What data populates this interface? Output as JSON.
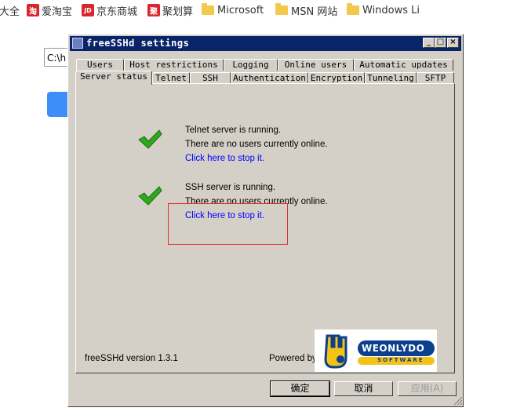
{
  "bookmarks": {
    "items": [
      {
        "label": "大全"
      },
      {
        "label": "爱淘宝",
        "icon": "taobao-icon"
      },
      {
        "label": "京东商城",
        "icon": "jd-icon"
      },
      {
        "label": "聚划算",
        "icon": "juhuasuan-icon"
      },
      {
        "label": "Microsoft",
        "icon": "folder-icon"
      },
      {
        "label": "MSN 网站",
        "icon": "folder-icon"
      },
      {
        "label": "Windows Li",
        "icon": "folder-icon"
      }
    ],
    "icon_glyphs": {
      "taobao": "淘",
      "jd": "JD",
      "juhuasuan": "聚"
    }
  },
  "background": {
    "input_value": "C:\\h"
  },
  "window": {
    "title": "freeSSHd settings",
    "caption_buttons": {
      "minimize": "_",
      "maximize": "□",
      "close": "×"
    }
  },
  "tabs": {
    "row1": [
      "Users",
      "Host restrictions",
      "Logging",
      "Online users",
      "Automatic updates"
    ],
    "row2": [
      "Server status",
      "Telnet",
      "SSH",
      "Authentication",
      "Encryption",
      "Tunneling",
      "SFTP"
    ],
    "active": "Server status"
  },
  "status": {
    "telnet": {
      "running": "Telnet server is running.",
      "users": "There are no users currently online.",
      "link": "Click here to stop it."
    },
    "ssh": {
      "running": "SSH server is running.",
      "users": "There are no users currently online.",
      "link": "Click here to stop it."
    }
  },
  "footer": {
    "version": "freeSSHd version 1.3.1",
    "powered_by": "Powered by",
    "logo_text": "WEONLYDO",
    "logo_sub": "SOFTWARE"
  },
  "buttons": {
    "ok": "确定",
    "cancel": "取消",
    "apply": "应用(A)"
  },
  "colors": {
    "titlebar": "#0a246a",
    "dialog": "#d4d0c8",
    "link": "#0000ff",
    "check": "#2fa81c",
    "highlight": "#e03030",
    "logo_blue": "#0d3f8f",
    "logo_yellow": "#f3c316"
  }
}
